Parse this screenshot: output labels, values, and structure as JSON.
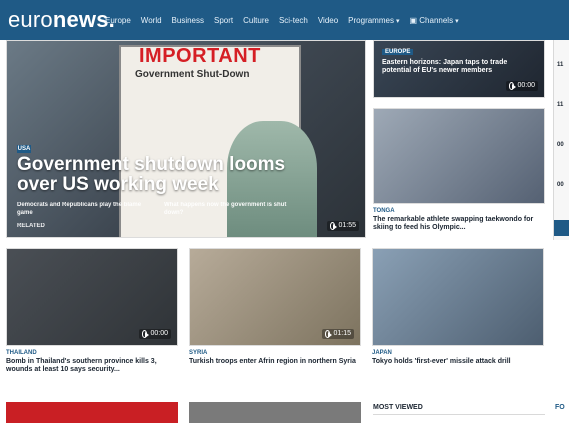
{
  "colors": {
    "brand_blue": "#1f5a86",
    "tag_blue": "#1f5a86",
    "headline_dark": "#1a2430",
    "important_red": "#d51f25"
  },
  "header": {
    "logo": {
      "euro": "euro",
      "news": "news."
    },
    "nav": {
      "items": [
        {
          "label": "Europe"
        },
        {
          "label": "World"
        },
        {
          "label": "Business"
        },
        {
          "label": "Sport"
        },
        {
          "label": "Culture"
        },
        {
          "label": "Sci-tech"
        },
        {
          "label": "Video"
        },
        {
          "label": "Programmes"
        },
        {
          "label": "Channels"
        }
      ]
    }
  },
  "hero": {
    "poster_title": "IMPORTANT",
    "poster_sub": "Government Shut-Down",
    "badge": "USA",
    "title": "Government shutdown looms over US working week",
    "related_label": "RELATED",
    "related_items": [
      {
        "text": "Democrats and Republicans play the blame game"
      },
      {
        "text": "What happens now the government is shut down?"
      }
    ],
    "duration": "01:55"
  },
  "right": {
    "top": {
      "tag": "EUROPE",
      "headline": "Eastern horizons: Japan taps to trade potential of EU's newer members",
      "duration": "00:00"
    },
    "second": {
      "tag": "TONGA",
      "headline": "The remarkable athlete swapping taekwondo for skiing to feed his Olympic..."
    }
  },
  "grid": {
    "cards": [
      {
        "tag": "THAILAND",
        "headline": "Bomb in Thailand's southern province kills 3, wounds at least 10 says security...",
        "duration": "00:00"
      },
      {
        "tag": "SYRIA",
        "headline": "Turkish troops enter Afrin region in northern Syria",
        "duration": "01:15"
      },
      {
        "tag": "JAPAN",
        "headline": "Tokyo holds 'first-ever' missile attack drill"
      }
    ]
  },
  "bottom": {
    "most_viewed": "MOST VIEWED",
    "fo": "FO"
  },
  "sidebar": {
    "marks": [
      "11",
      "11",
      "00",
      "00"
    ]
  }
}
